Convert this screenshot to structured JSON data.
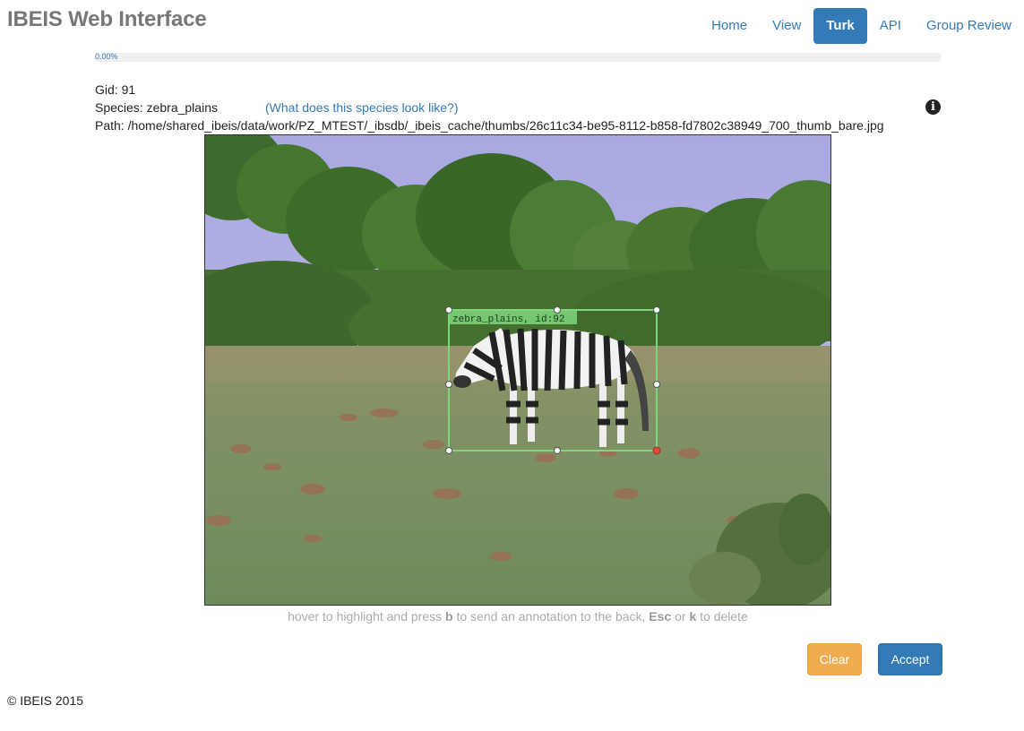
{
  "brand": "IBEIS Web Interface",
  "nav": [
    {
      "label": "Home",
      "active": false
    },
    {
      "label": "View",
      "active": false
    },
    {
      "label": "Turk",
      "active": true
    },
    {
      "label": "API",
      "active": false
    },
    {
      "label": "Group Review",
      "active": false
    }
  ],
  "progress": {
    "percent": 0,
    "label": "0.00%"
  },
  "info": {
    "gid_label": "Gid:",
    "gid": "91",
    "species_label": "Species:",
    "species": "zebra_plains",
    "species_link": "(What does this species look like?)",
    "path_label": "Path:",
    "path": "/home/shared_ibeis/data/work/PZ_MTEST/_ibsdb/_ibeis_cache/thumbs/26c11c34-be95-8112-b858-fd7802c38949_700_thumb_bare.jpg"
  },
  "annotation": {
    "label": "zebra_plains, id:92",
    "color": "#7ed67e"
  },
  "hint": {
    "part1": "hover to highlight and press ",
    "key_b": "b",
    "part2": " to send an annotation to the back, ",
    "key_esc": "Esc",
    "part3": " or ",
    "key_k": "k",
    "part4": " to delete"
  },
  "buttons": {
    "clear": "Clear",
    "accept": "Accept"
  },
  "footer": "© IBEIS 2015",
  "icons": {
    "info": "info-circle-icon"
  },
  "colors": {
    "primary": "#337ab7",
    "warning": "#f0ad4e",
    "brand": "#777777"
  }
}
